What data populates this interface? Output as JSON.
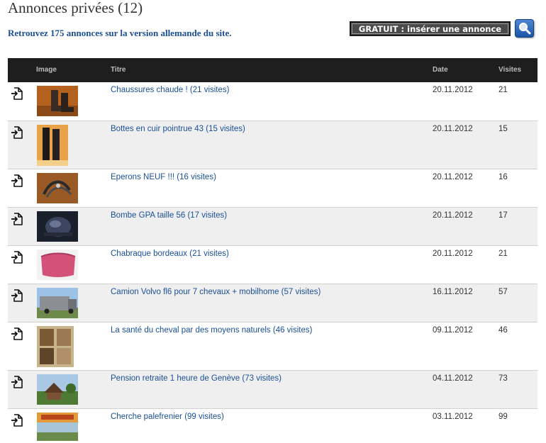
{
  "header": {
    "title": "Annonces privées (12)",
    "subtitle_link": "Retrouvez 175 annonces sur la version allemande du site.",
    "insert_button": "GRATUIT : insérer une annonce"
  },
  "icons": {
    "search": "search-icon",
    "row_icon": "document-arrow-icon"
  },
  "colors": {
    "link": "#1a4f96",
    "header_bg": "#1e1e1e",
    "row_alt": "#efefef",
    "search_btn": "#2a63b6"
  },
  "table": {
    "columns": [
      "Image",
      "Titre",
      "Date",
      "Visites"
    ],
    "rows": [
      {
        "title": "Chaussures chaude ! (21 visites)",
        "date": "20.11.2012",
        "visits": "21"
      },
      {
        "title": "Bottes en cuir pointrue 43 (15 visites)",
        "date": "20.11.2012",
        "visits": "15"
      },
      {
        "title": "Eperons NEUF !!! (16 visites)",
        "date": "20.11.2012",
        "visits": "16"
      },
      {
        "title": "Bombe GPA taille 56 (17 visites)",
        "date": "20.11.2012",
        "visits": "17"
      },
      {
        "title": "Chabraque bordeaux (21 visites)",
        "date": "20.11.2012",
        "visits": "21"
      },
      {
        "title": "Camion Volvo fl6 pour 7 chevaux + mobilhome (57 visites)",
        "date": "16.11.2012",
        "visits": "57"
      },
      {
        "title": "La santé du cheval par des moyens naturels (46 visites)",
        "date": "09.11.2012",
        "visits": "46"
      },
      {
        "title": "Pension retraite 1 heure de Genève (73 visites)",
        "date": "04.11.2012",
        "visits": "73"
      },
      {
        "title": "Cherche palefrenier (99 visites)",
        "date": "03.11.2012",
        "visits": "99"
      }
    ]
  }
}
